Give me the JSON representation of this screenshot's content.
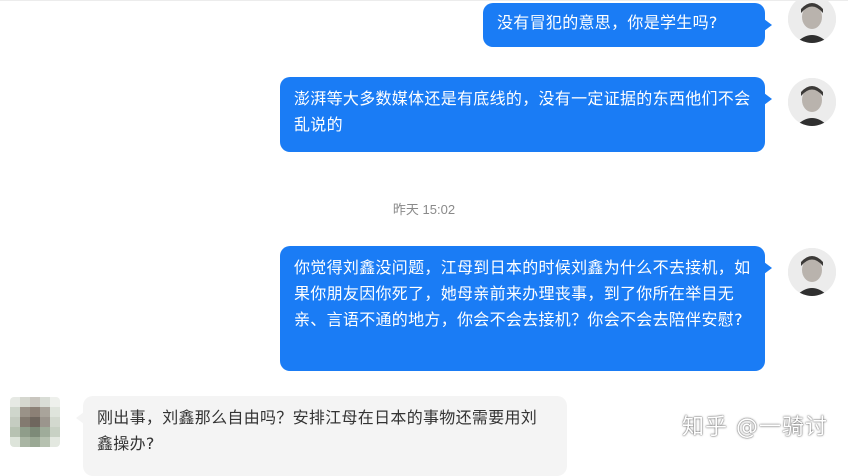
{
  "conversation": {
    "messages": [
      {
        "direction": "outgoing",
        "text": "没有冒犯的意思，你是学生吗?"
      },
      {
        "direction": "outgoing",
        "text": "澎湃等大多数媒体还是有底线的，没有一定证据的东西他们不会乱说的"
      },
      {
        "direction": "outgoing",
        "text": "你觉得刘鑫没问题，江母到日本的时候刘鑫为什么不去接机，如果你朋友因你死了，她母亲前来办理丧事，到了你所在举目无亲、言语不通的地方，你会不会去接机？你会不会去陪伴安慰?"
      },
      {
        "direction": "incoming",
        "text": "刚出事，刘鑫那么自由吗？安排江母在日本的事物还需要用刘鑫操办?"
      }
    ],
    "timestamp": "昨天 15:02"
  },
  "watermark": {
    "text": "知乎 @一骑讨"
  },
  "colors": {
    "outgoing_bubble": "#1a7cf5",
    "incoming_bubble": "#f4f4f4",
    "timestamp_text": "#8a8a8a"
  },
  "icons": {
    "self_avatar": "user-avatar-icon",
    "other_avatar": "blurred-avatar-icon"
  }
}
